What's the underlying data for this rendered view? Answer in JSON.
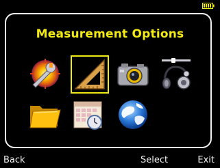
{
  "header": {
    "title": "Measurement Options"
  },
  "menu": {
    "items": [
      {
        "icon": "settings-wrench-icon",
        "selected": false
      },
      {
        "icon": "ruler-triangle-icon",
        "selected": true
      },
      {
        "icon": "camera-icon",
        "selected": false
      },
      {
        "icon": "audio-headset-icon",
        "selected": false
      },
      {
        "icon": "folder-icon",
        "selected": false
      },
      {
        "icon": "calendar-clock-icon",
        "selected": false
      },
      {
        "icon": "globe-icon",
        "selected": false
      }
    ]
  },
  "softkeys": {
    "left": "Back",
    "center": "Select",
    "right": "Exit"
  },
  "colors": {
    "background": "#000000",
    "title": "#f2ea14",
    "selection": "#f2ea14",
    "frame": "#f2f2f2"
  }
}
